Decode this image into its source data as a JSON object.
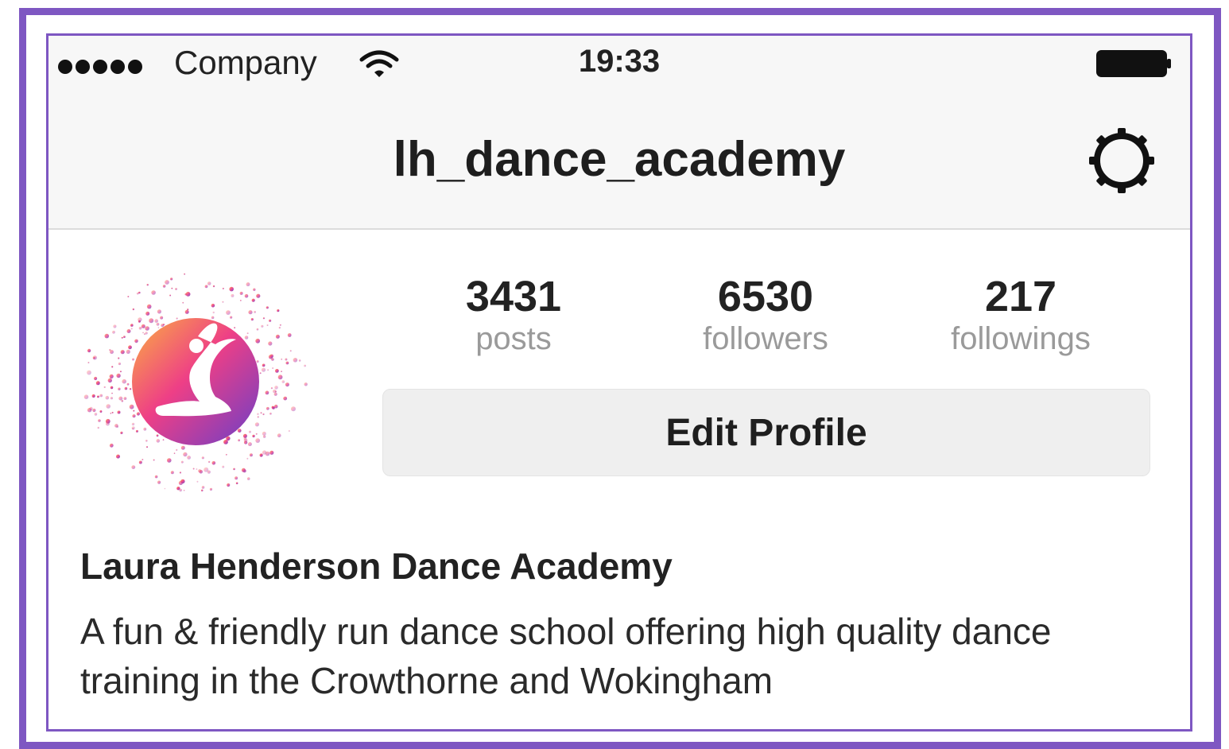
{
  "status_bar": {
    "carrier": "Company",
    "time": "19:33",
    "signal_icon": "signal-dots-icon",
    "wifi_icon": "wifi-icon",
    "battery_icon": "battery-icon"
  },
  "nav": {
    "title": "lh_dance_academy",
    "settings_icon": "gear-icon"
  },
  "profile": {
    "avatar_icon": "dancer-logo",
    "stats": [
      {
        "value": "3431",
        "label": "posts"
      },
      {
        "value": "6530",
        "label": "followers"
      },
      {
        "value": "217",
        "label": "followings"
      }
    ],
    "edit_button": "Edit Profile",
    "name": "Laura Henderson Dance Academy",
    "bio": "A fun & friendly run dance school offering high quality dance training in the Crowthorne and Wokingham"
  },
  "colors": {
    "frame": "#7e57c2",
    "bar_background": "#f7f7f7",
    "button_background": "#efefef",
    "muted_text": "#9a9a9a"
  }
}
